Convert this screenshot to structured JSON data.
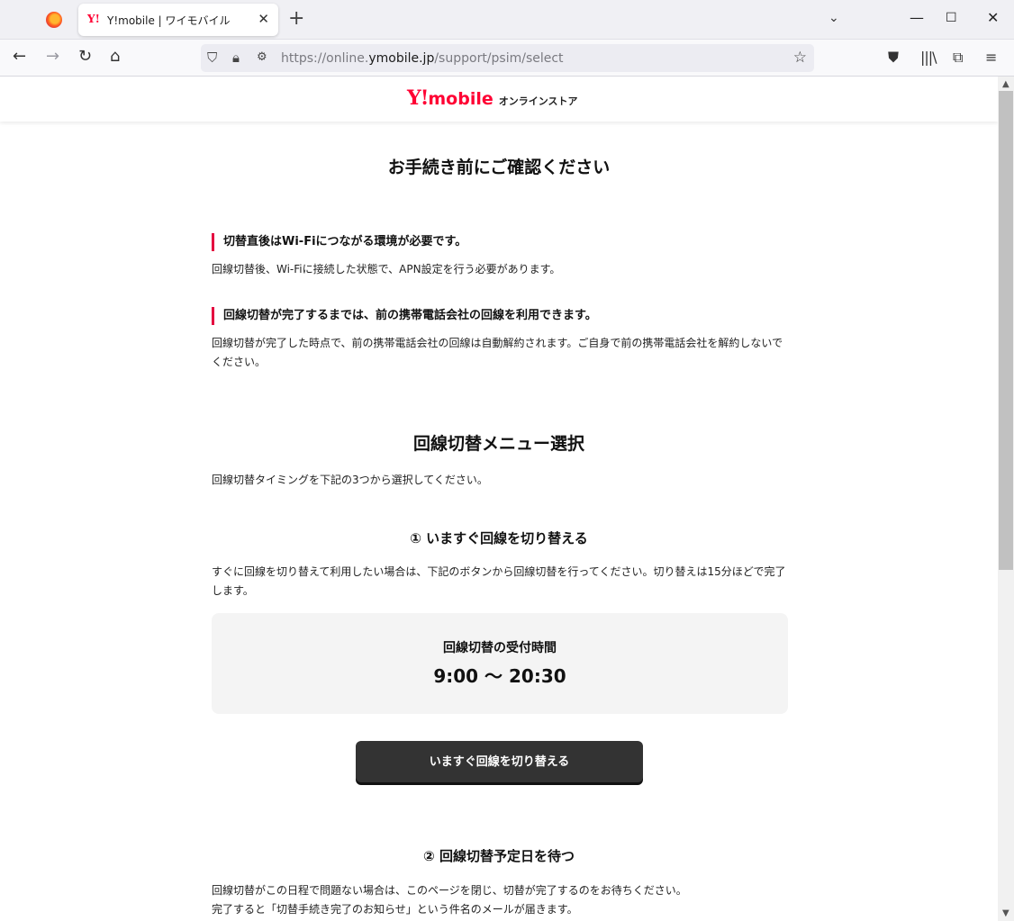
{
  "browser": {
    "tab_title": "Y!mobile | ワイモバイル",
    "tab_favicon": "Y!",
    "url_prefix": "https://online.",
    "url_host": "ymobile.jp",
    "url_path": "/support/psim/select",
    "icons": [
      "firefox-icon",
      "close-tab-icon",
      "new-tab-icon",
      "tab-list-icon",
      "minimize-icon",
      "maximize-icon",
      "close-window-icon",
      "back-icon",
      "forward-icon",
      "reload-icon",
      "home-icon",
      "shield-icon",
      "lock-icon",
      "permissions-icon",
      "bookmark-star-icon",
      "pocket-icon",
      "library-icon",
      "extensions-icon",
      "menu-icon"
    ]
  },
  "header": {
    "logo_y": "Y!",
    "logo_mobile": "mobile",
    "store_label": "オンラインストア"
  },
  "page_title": "お手続き前にご確認ください",
  "notices": [
    {
      "heading": "切替直後はWi-Fiにつながる環境が必要です。",
      "body": "回線切替後、Wi-Fiに接続した状態で、APN設定を行う必要があります。"
    },
    {
      "heading": "回線切替が完了するまでは、前の携帯電話会社の回線を利用できます。",
      "body": "回線切替が完了した時点で、前の携帯電話会社の回線は自動解約されます。ご自身で前の携帯電話会社を解約しないでください。"
    }
  ],
  "menu": {
    "title": "回線切替メニュー選択",
    "intro": "回線切替タイミングを下記の3つから選択してください。",
    "option1": {
      "title": "① いますぐ回線を切り替える",
      "body": "すぐに回線を切り替えて利用したい場合は、下記のボタンから回線切替を行ってください。切り替えは15分ほどで完了します。",
      "hours_label": "回線切替の受付時間",
      "hours_value": "9:00 〜 20:30",
      "button_label": "いますぐ回線を切り替える"
    },
    "option2": {
      "title": "② 回線切替予定日を待つ",
      "body_line1": "回線切替がこの日程で問題ない場合は、このページを閉じ、切替が完了するのをお待ちください。",
      "body_line2": "完了すると「切替手続き完了のお知らせ」という件名のメールが届きます。"
    }
  },
  "colors": {
    "brand_red": "#ff0033",
    "accent_bar": "#e4003f",
    "button_bg": "#333333",
    "hours_box_bg": "#f4f4f4"
  }
}
